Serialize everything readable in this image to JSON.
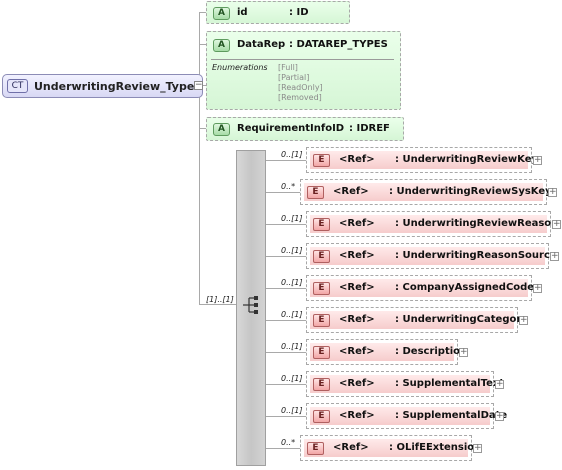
{
  "complex_type": {
    "badge": "CT",
    "name": "UnderwritingReview_Type",
    "collapse_symbol": "−"
  },
  "attributes": [
    {
      "badge": "A",
      "name": "id",
      "type": ": ID"
    },
    {
      "badge": "A",
      "name": "DataRep",
      "type": ": DATAREP_TYPES",
      "enum_title": "Enumerations",
      "enumerations": [
        "[Full]",
        "[Partial]",
        "[ReadOnly]",
        "[Removed]"
      ]
    },
    {
      "badge": "A",
      "name": "RequirementInfoID",
      "type": ": IDREF"
    }
  ],
  "sequence": {
    "multiplicity": "[1]..[1]"
  },
  "elements": [
    {
      "badge": "E",
      "ref": "<Ref>",
      "name": ": UnderwritingReviewKey",
      "multiplicity": "0..[1]",
      "expand": "+"
    },
    {
      "badge": "E",
      "ref": "<Ref>",
      "name": ": UnderwritingReviewSysKey",
      "multiplicity": "0..*",
      "expand": "+"
    },
    {
      "badge": "E",
      "ref": "<Ref>",
      "name": ": UnderwritingReviewReason",
      "multiplicity": "0..[1]",
      "expand": "+"
    },
    {
      "badge": "E",
      "ref": "<Ref>",
      "name": ": UnderwritingReasonSource",
      "multiplicity": "0..[1]",
      "expand": "+"
    },
    {
      "badge": "E",
      "ref": "<Ref>",
      "name": ": CompanyAssignedCode",
      "multiplicity": "0..[1]",
      "expand": "+"
    },
    {
      "badge": "E",
      "ref": "<Ref>",
      "name": ": UnderwritingCategory",
      "multiplicity": "0..[1]",
      "expand": "+"
    },
    {
      "badge": "E",
      "ref": "<Ref>",
      "name": ": Description",
      "multiplicity": "0..[1]",
      "expand": "+"
    },
    {
      "badge": "E",
      "ref": "<Ref>",
      "name": ": SupplementalText",
      "multiplicity": "0..[1]",
      "expand": "+"
    },
    {
      "badge": "E",
      "ref": "<Ref>",
      "name": ": SupplementalDate",
      "multiplicity": "0..[1]",
      "expand": "+"
    },
    {
      "badge": "E",
      "ref": "<Ref>",
      "name": ": OLifEExtension",
      "multiplicity": "0..*",
      "expand": "+"
    }
  ]
}
